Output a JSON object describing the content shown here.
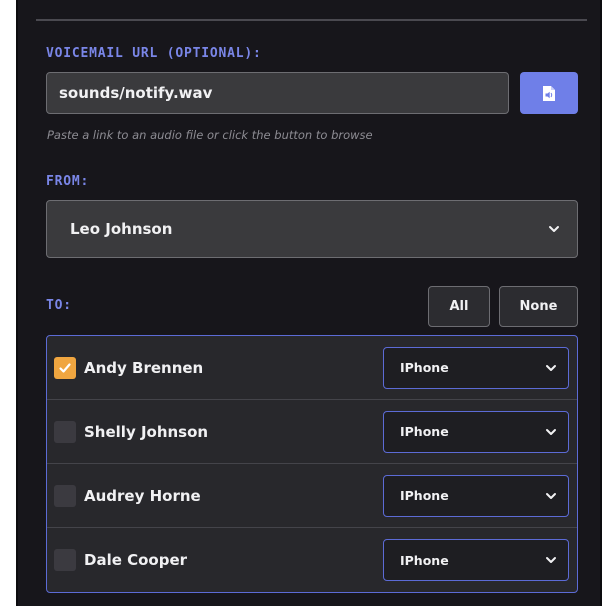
{
  "voicemail": {
    "label": "VOICEMAIL URL (OPTIONAL):",
    "value": "sounds/notify.wav",
    "hint": "Paste a link to an audio file or click the button to browse",
    "browse_icon": "audio-file-icon"
  },
  "from": {
    "label": "FROM:",
    "selected": "Leo Johnson"
  },
  "to": {
    "label": "TO:",
    "all_label": "All",
    "none_label": "None",
    "recipients": [
      {
        "name": "Andy Brennen",
        "checked": true,
        "device": "IPhone"
      },
      {
        "name": "Shelly Johnson",
        "checked": false,
        "device": "IPhone"
      },
      {
        "name": "Audrey Horne",
        "checked": false,
        "device": "IPhone"
      },
      {
        "name": "Dale Cooper",
        "checked": false,
        "device": "IPhone"
      }
    ]
  },
  "colors": {
    "accent": "#6f7fe8",
    "label": "#7a86e8",
    "check": "#f0a640",
    "panel": "#17161b"
  }
}
